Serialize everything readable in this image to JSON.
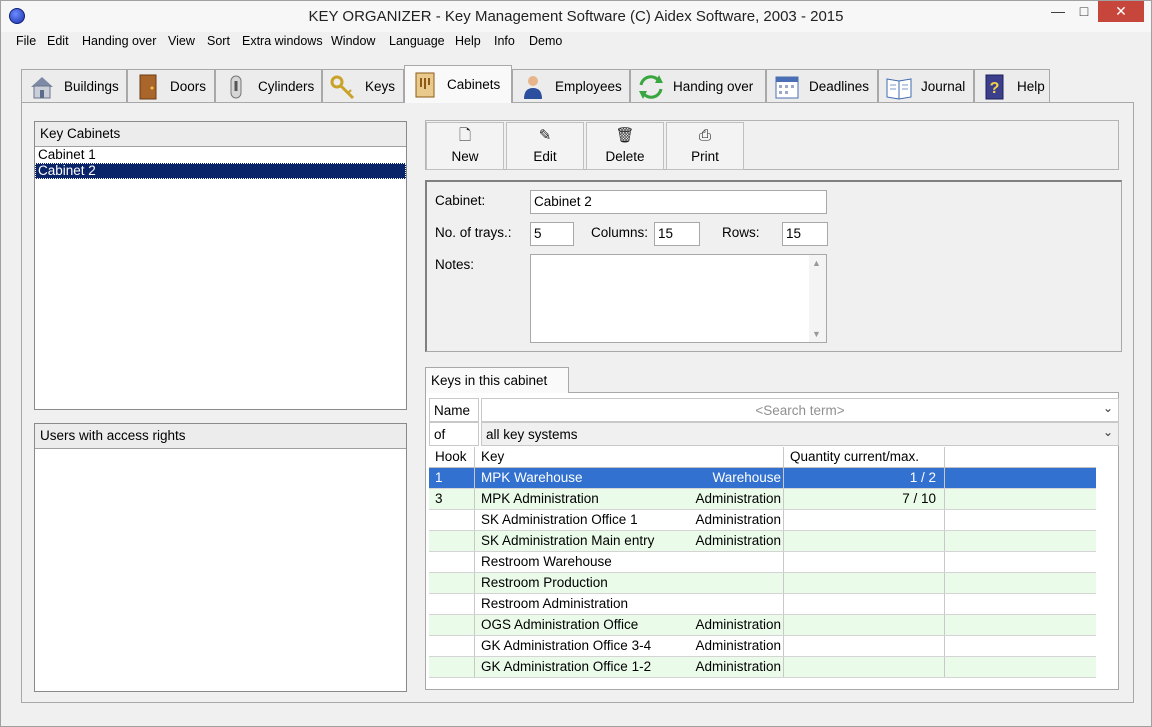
{
  "window": {
    "title": "KEY ORGANIZER  -  Key Management Software    (C) Aidex Software, 2003 - 2015",
    "minimize": "—",
    "maximize": "□",
    "close": "✕"
  },
  "menu": [
    "File",
    "Edit",
    "Handing over",
    "View",
    "Sort",
    "Extra windows",
    "Window",
    "Language",
    "Help",
    "Info",
    "Demo"
  ],
  "tabs": [
    {
      "label": "Buildings",
      "icon": "building-icon"
    },
    {
      "label": "Doors",
      "icon": "door-icon"
    },
    {
      "label": "Cylinders",
      "icon": "cylinder-icon"
    },
    {
      "label": "Keys",
      "icon": "key-icon"
    },
    {
      "label": "Cabinets",
      "icon": "cabinet-icon",
      "active": true
    },
    {
      "label": "Employees",
      "icon": "employee-icon"
    },
    {
      "label": "Handing over",
      "icon": "handing-over-icon"
    },
    {
      "label": "Deadlines",
      "icon": "calendar-icon"
    },
    {
      "label": "Journal",
      "icon": "journal-icon"
    },
    {
      "label": "Help",
      "icon": "help-book-icon"
    }
  ],
  "cabinets_panel": {
    "header": "Key Cabinets",
    "items": [
      "Cabinet 1",
      "Cabinet 2"
    ],
    "selected_index": 1
  },
  "users_panel": {
    "header": "Users with access rights"
  },
  "toolbar": {
    "new": "New",
    "edit": "Edit",
    "delete": "Delete",
    "print": "Print"
  },
  "details": {
    "cabinet_label": "Cabinet:",
    "cabinet_value": "Cabinet 2",
    "trays_label": "No. of trays.:",
    "trays_value": "5",
    "columns_label": "Columns:",
    "columns_value": "15",
    "rows_label": "Rows:",
    "rows_value": "15",
    "notes_label": "Notes:",
    "notes_value": ""
  },
  "keys_section": {
    "tab_label": "Keys in this cabinet",
    "name_label": "Name",
    "search_placeholder": "<Search term>",
    "of_label": "of",
    "system_value": "all key systems",
    "columns": {
      "hook": "Hook",
      "key": "Key",
      "quantity": "Quantity current/max."
    },
    "rows": [
      {
        "hook": "1",
        "key": "MPK Warehouse",
        "group": "Warehouse",
        "quantity": "1 /   2"
      },
      {
        "hook": "3",
        "key": "MPK Administration",
        "group": "Administration",
        "quantity": "7 / 10"
      },
      {
        "hook": "",
        "key": "SK Administration Office 1",
        "group": "Administration",
        "quantity": ""
      },
      {
        "hook": "",
        "key": "SK Administration Main entry",
        "group": "Administration",
        "quantity": ""
      },
      {
        "hook": "",
        "key": "Restroom Warehouse",
        "group": "",
        "quantity": ""
      },
      {
        "hook": "",
        "key": "Restroom Production",
        "group": "",
        "quantity": ""
      },
      {
        "hook": "",
        "key": "Restroom Administration",
        "group": "",
        "quantity": ""
      },
      {
        "hook": "",
        "key": "OGS Administration Office",
        "group": "Administration",
        "quantity": ""
      },
      {
        "hook": "",
        "key": "GK Administration Office 3-4",
        "group": "Administration",
        "quantity": ""
      },
      {
        "hook": "",
        "key": "GK Administration Office 1-2",
        "group": "Administration",
        "quantity": ""
      }
    ],
    "selected_row": 0
  }
}
